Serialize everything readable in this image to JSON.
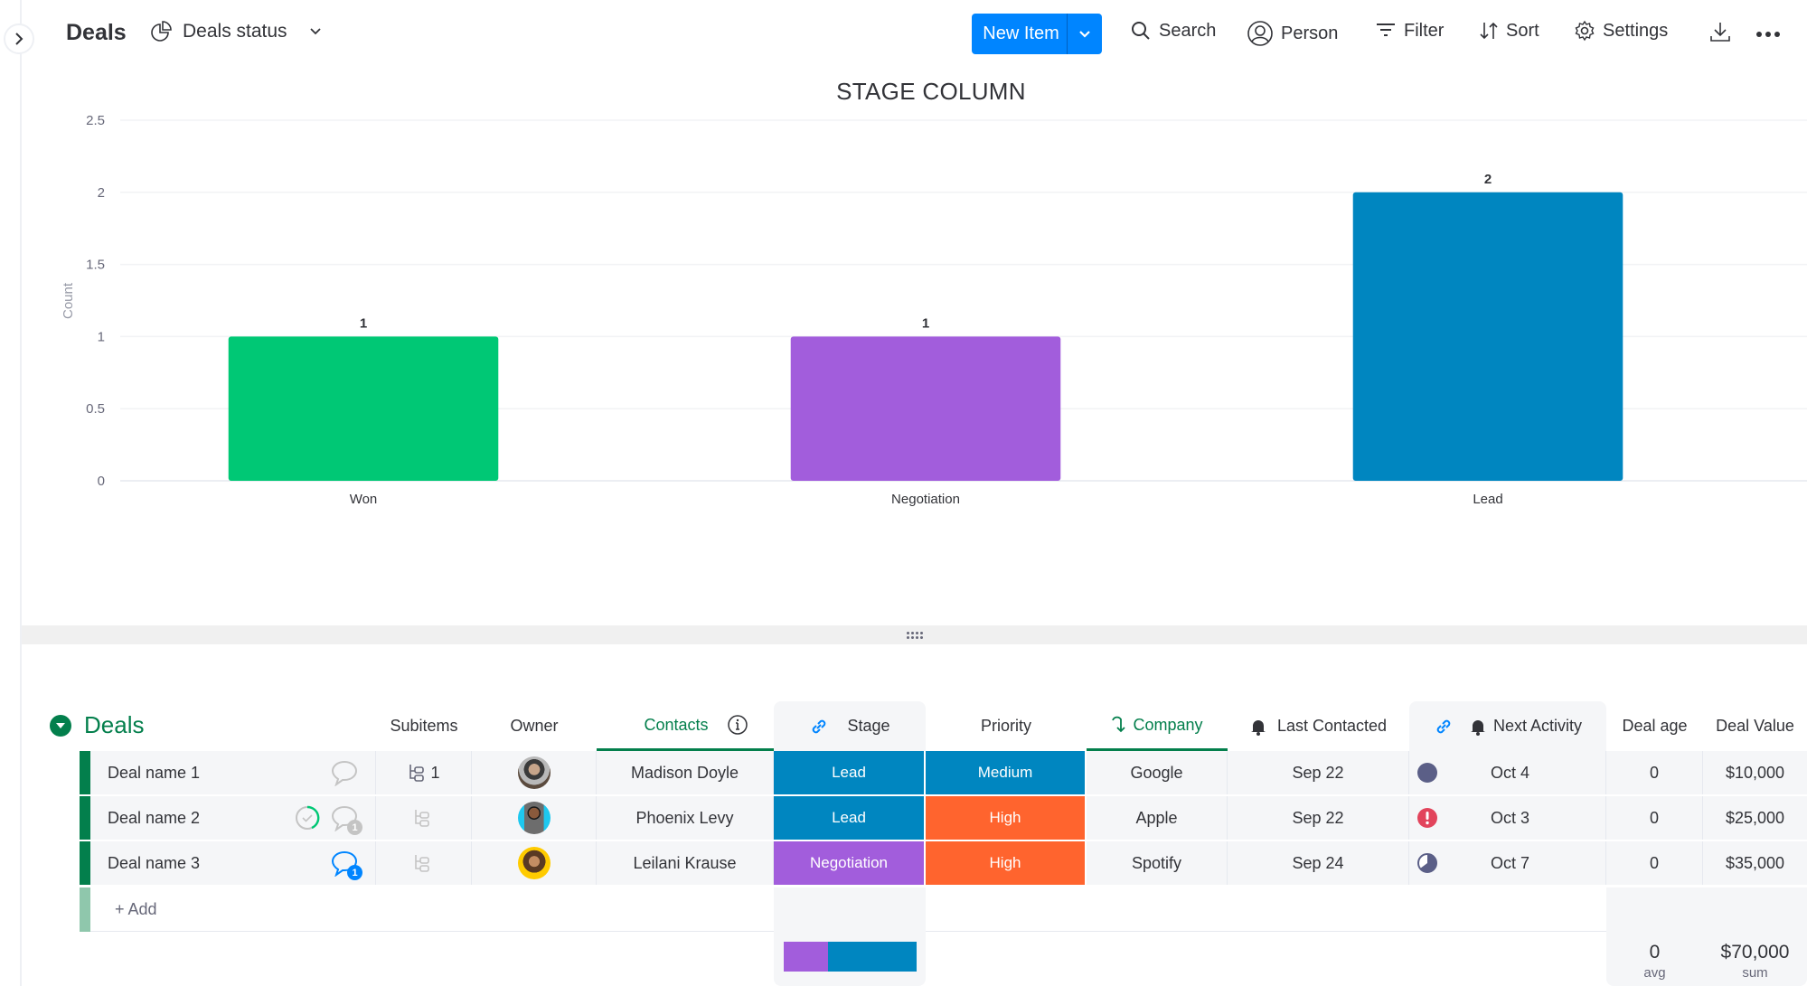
{
  "header": {
    "board_title": "Deals",
    "view_name": "Deals status",
    "new_item_label": "New Item",
    "toolbar": {
      "search": "Search",
      "person": "Person",
      "filter": "Filter",
      "sort": "Sort",
      "settings": "Settings"
    }
  },
  "colors": {
    "accent": "#0085ff",
    "won": "#00c875",
    "negotiation": "#a25ddc",
    "lead": "#0086c0",
    "medium": "#0086c0",
    "high": "#ff642e",
    "group": "#037f4c"
  },
  "chart_data": {
    "type": "bar",
    "title": "STAGE COLUMN",
    "categories": [
      "Won",
      "Negotiation",
      "Lead"
    ],
    "values": [
      1,
      1,
      2
    ],
    "value_labels": [
      "1",
      "1",
      "2"
    ],
    "bar_colors": [
      "#00c875",
      "#a25ddc",
      "#0086c0"
    ],
    "xlabel": "",
    "ylabel": "Count",
    "ylim": [
      0,
      2.5
    ],
    "yticks": [
      "0",
      "0.5",
      "1",
      "1.5",
      "2",
      "2.5"
    ],
    "ytick_values": [
      0,
      0.5,
      1,
      1.5,
      2,
      2.5
    ],
    "grid": true,
    "legend": "none"
  },
  "group": {
    "title": "Deals",
    "columns": {
      "subitems": "Subitems",
      "owner": "Owner",
      "contacts": "Contacts",
      "stage": "Stage",
      "priority": "Priority",
      "company": "Company",
      "last_contacted": "Last Contacted",
      "next_activity": "Next Activity",
      "deal_age": "Deal age",
      "deal_value": "Deal Value"
    },
    "rows": [
      {
        "name": "Deal name 1",
        "subitems_count": "1",
        "updates_badge": "",
        "contact": "Madison Doyle",
        "stage": "Lead",
        "priority": "Medium",
        "company": "Google",
        "last_contacted": "Sep 22",
        "activity_status": "scheduled",
        "next_activity": "Oct 4",
        "deal_age": "0",
        "deal_value": "$10,000"
      },
      {
        "name": "Deal name 2",
        "subitems_count": "",
        "updates_badge": "1",
        "contact": "Phoenix Levy",
        "stage": "Lead",
        "priority": "High",
        "company": "Apple",
        "last_contacted": "Sep 22",
        "activity_status": "overdue",
        "next_activity": "Oct 3",
        "deal_age": "0",
        "deal_value": "$25,000"
      },
      {
        "name": "Deal name 3",
        "subitems_count": "",
        "updates_badge": "1",
        "contact": "Leilani Krause",
        "stage": "Negotiation",
        "priority": "High",
        "company": "Spotify",
        "last_contacted": "Sep 24",
        "activity_status": "in-progress",
        "next_activity": "Oct 7",
        "deal_age": "0",
        "deal_value": "$35,000"
      }
    ],
    "add_label": "+ Add",
    "summary": {
      "stage_distribution": [
        {
          "label": "Negotiation",
          "fraction": 0.333,
          "color": "#a25ddc"
        },
        {
          "label": "Lead",
          "fraction": 0.667,
          "color": "#0086c0"
        }
      ],
      "deal_age_value": "0",
      "deal_age_label": "avg",
      "deal_value_value": "$70,000",
      "deal_value_label": "sum"
    }
  }
}
